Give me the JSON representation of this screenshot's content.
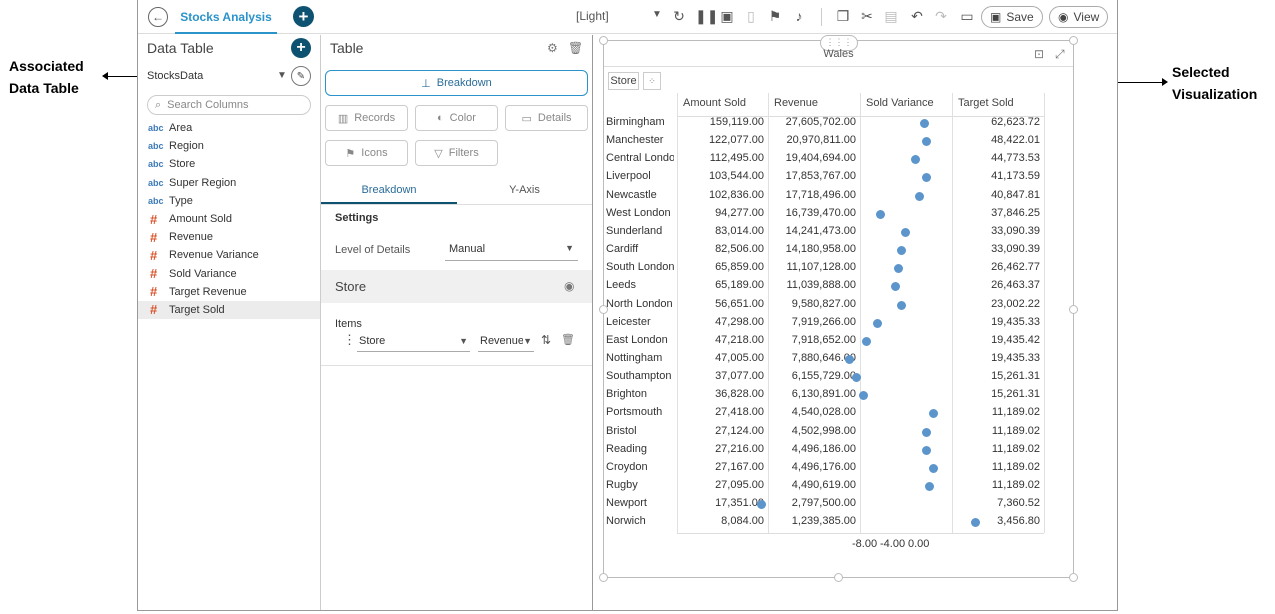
{
  "annotations": {
    "left_line1": "Associated",
    "left_line2": "Data Table",
    "right_line1": "Selected",
    "right_line2": "Visualization"
  },
  "topbar": {
    "tab_title": "Stocks Analysis",
    "theme": "[Light]",
    "save_label": "Save",
    "view_label": "View"
  },
  "left_panel": {
    "title": "Data Table",
    "data_source": "StocksData",
    "search_placeholder": "Search Columns",
    "columns": [
      {
        "type": "abc",
        "name": "Area"
      },
      {
        "type": "abc",
        "name": "Region"
      },
      {
        "type": "abc",
        "name": "Store"
      },
      {
        "type": "abc",
        "name": "Super Region"
      },
      {
        "type": "abc",
        "name": "Type"
      },
      {
        "type": "#",
        "name": "Amount Sold"
      },
      {
        "type": "#",
        "name": "Revenue"
      },
      {
        "type": "#",
        "name": "Revenue Variance"
      },
      {
        "type": "#",
        "name": "Sold Variance"
      },
      {
        "type": "#",
        "name": "Target Revenue"
      },
      {
        "type": "#",
        "name": "Target Sold"
      }
    ]
  },
  "mid_panel": {
    "title": "Table",
    "breakdown_label": "Breakdown",
    "records_label": "Records",
    "color_label": "Color",
    "details_label": "Details",
    "icons_label": "Icons",
    "filters_label": "Filters",
    "tab_breakdown": "Breakdown",
    "tab_yaxis": "Y-Axis",
    "settings_label": "Settings",
    "lod_label": "Level of Details",
    "lod_value": "Manual",
    "store_label": "Store",
    "items_label": "Items",
    "item_field": "Store",
    "item_sort": "Revenue"
  },
  "viz": {
    "title": "Wales",
    "store_chip": "Store",
    "headers": [
      "Amount Sold",
      "Revenue",
      "Sold Variance",
      "Target Sold"
    ],
    "rows": [
      {
        "store": "Birmingham",
        "amount": "159,119.00",
        "revenue": "27,605,702.00",
        "variance": 0.3,
        "target": "62,623.72"
      },
      {
        "store": "Manchester",
        "amount": "122,077.00",
        "revenue": "20,970,811.00",
        "variance": 0.5,
        "target": "48,422.01"
      },
      {
        "store": "Central London",
        "amount": "112,495.00",
        "revenue": "19,404,694.00",
        "variance": -1.0,
        "target": "44,773.53"
      },
      {
        "store": "Liverpool",
        "amount": "103,544.00",
        "revenue": "17,853,767.00",
        "variance": 0.5,
        "target": "41,173.59"
      },
      {
        "store": "Newcastle",
        "amount": "102,836.00",
        "revenue": "17,718,496.00",
        "variance": -0.5,
        "target": "40,847.81"
      },
      {
        "store": "West London",
        "amount": "94,277.00",
        "revenue": "16,739,470.00",
        "variance": -6.0,
        "target": "37,846.25"
      },
      {
        "store": "Sunderland",
        "amount": "83,014.00",
        "revenue": "14,241,473.00",
        "variance": -2.5,
        "target": "33,090.39"
      },
      {
        "store": "Cardiff",
        "amount": "82,506.00",
        "revenue": "14,180,958.00",
        "variance": -3.0,
        "target": "33,090.39"
      },
      {
        "store": "South London",
        "amount": "65,859.00",
        "revenue": "11,107,128.00",
        "variance": -3.5,
        "target": "26,462.77"
      },
      {
        "store": "Leeds",
        "amount": "65,189.00",
        "revenue": "11,039,888.00",
        "variance": -3.8,
        "target": "26,463.37"
      },
      {
        "store": "North London",
        "amount": "56,651.00",
        "revenue": "9,580,827.00",
        "variance": -3.0,
        "target": "23,002.22"
      },
      {
        "store": "Leicester",
        "amount": "47,298.00",
        "revenue": "7,919,266.00",
        "variance": -6.5,
        "target": "19,435.33"
      },
      {
        "store": "East London",
        "amount": "47,218.00",
        "revenue": "7,918,652.00",
        "variance": -8.0,
        "target": "19,435.42"
      },
      {
        "store": "Nottingham",
        "amount": "47,005.00",
        "revenue": "7,880,646.00",
        "variance": -10.5,
        "target": "19,435.33"
      },
      {
        "store": "Southampton",
        "amount": "37,077.00",
        "revenue": "6,155,729.00",
        "variance": -9.5,
        "target": "15,261.31"
      },
      {
        "store": "Brighton",
        "amount": "36,828.00",
        "revenue": "6,130,891.00",
        "variance": -8.5,
        "target": "15,261.31"
      },
      {
        "store": "Portsmouth",
        "amount": "27,418.00",
        "revenue": "4,540,028.00",
        "variance": 1.5,
        "target": "11,189.02"
      },
      {
        "store": "Bristol",
        "amount": "27,124.00",
        "revenue": "4,502,998.00",
        "variance": 0.5,
        "target": "11,189.02"
      },
      {
        "store": "Reading",
        "amount": "27,216.00",
        "revenue": "4,496,186.00",
        "variance": 0.5,
        "target": "11,189.02"
      },
      {
        "store": "Croydon",
        "amount": "27,167.00",
        "revenue": "4,496,176.00",
        "variance": 1.5,
        "target": "11,189.02"
      },
      {
        "store": "Rugby",
        "amount": "27,095.00",
        "revenue": "4,490,619.00",
        "variance": 1.0,
        "target": "11,189.02"
      },
      {
        "store": "Newport",
        "amount": "17,351.00",
        "revenue": "2,797,500.00",
        "variance": -23.0,
        "target": "7,360.52"
      },
      {
        "store": "Norwich",
        "amount": "8,084.00",
        "revenue": "1,239,385.00",
        "variance": 7.5,
        "target": "3,456.80"
      }
    ],
    "axis_ticks": [
      "-8.00",
      "-4.00",
      "0.00"
    ]
  }
}
